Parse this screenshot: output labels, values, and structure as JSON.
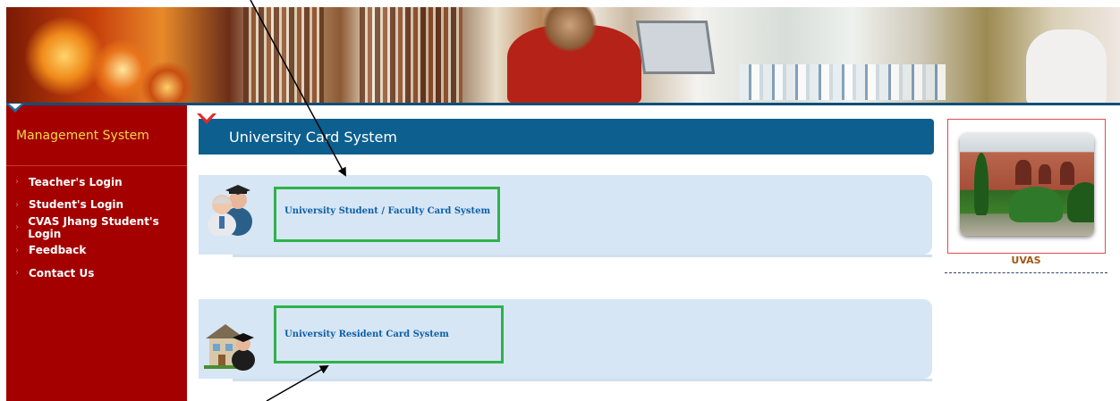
{
  "sidebar": {
    "title": "Management System",
    "items": [
      {
        "label": "Teacher's Login"
      },
      {
        "label": "Student's Login"
      },
      {
        "label": "CVAS Jhang Student's Login"
      },
      {
        "label": "Feedback"
      },
      {
        "label": "Contact Us"
      }
    ]
  },
  "main": {
    "title": "University Card System",
    "cards": [
      {
        "label": "University Student / Faculty Card System",
        "icon": "people-icon"
      },
      {
        "label": "University Resident Card System",
        "icon": "house-graduate-icon"
      }
    ]
  },
  "aside": {
    "caption": "UVAS"
  },
  "colors": {
    "sidebar_bg": "#a40000",
    "sidebar_title": "#f3d84a",
    "header_bg": "#0c5f8e",
    "panel_bg": "#d7e6f5",
    "highlight_box": "#2db34a",
    "link": "#0c5fa8"
  }
}
